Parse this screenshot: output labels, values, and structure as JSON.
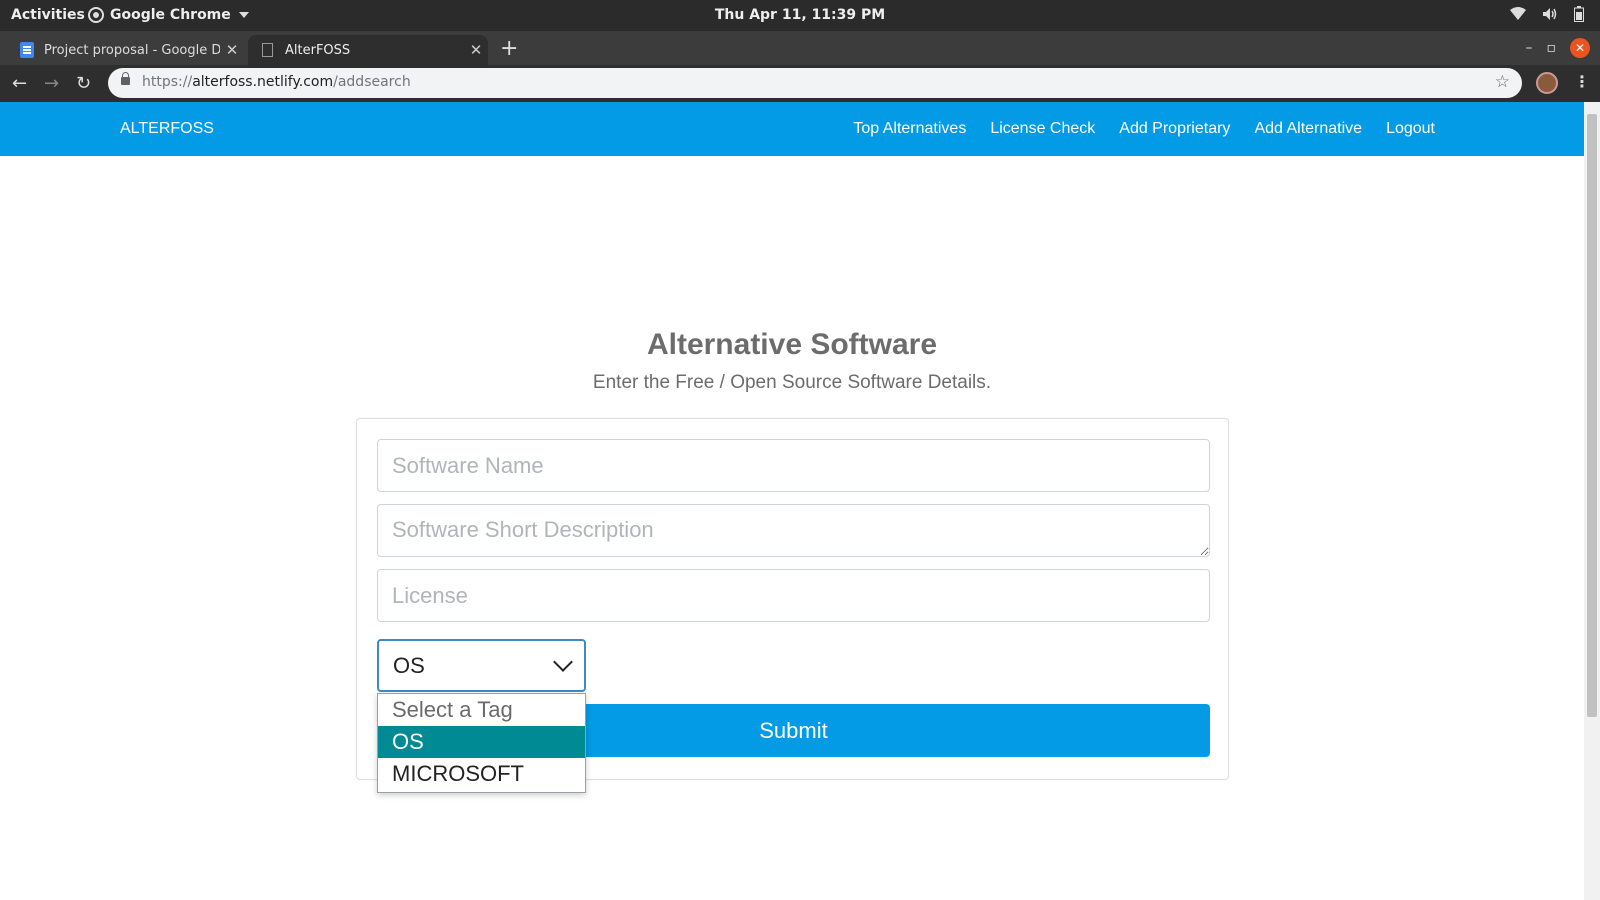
{
  "system_bar": {
    "activities": "Activities",
    "app_name": "Google Chrome",
    "clock": "Thu Apr 11, 11:39 PM"
  },
  "browser": {
    "tabs": [
      {
        "title": "Project proposal - Google Docs",
        "active": false
      },
      {
        "title": "AlterFOSS",
        "active": true
      }
    ],
    "url": {
      "scheme": "https://",
      "host": "alterfoss.netlify.com",
      "path": "/addsearch"
    }
  },
  "navbar": {
    "brand": "ALTERFOSS",
    "links": [
      "Top Alternatives",
      "License Check",
      "Add Proprietary",
      "Add Alternative",
      "Logout"
    ]
  },
  "form": {
    "title": "Alternative Software",
    "subtitle": "Enter the Free / Open Source Software Details.",
    "software_name_placeholder": "Software Name",
    "description_placeholder": "Software Short Description",
    "license_placeholder": "License",
    "tag_selected": "OS",
    "tag_options": [
      "Select a Tag",
      "OS",
      "MICROSOFT"
    ],
    "submit_label": "Submit"
  },
  "colors": {
    "navbar": "#039be5",
    "submit": "#039be5",
    "selected_option": "#008b94",
    "heading_text": "#6c6c6c"
  }
}
